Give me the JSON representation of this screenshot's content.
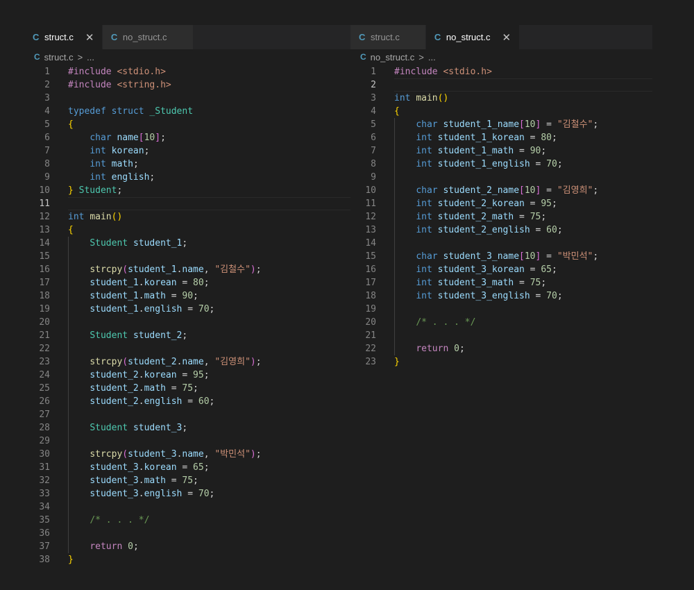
{
  "panes": [
    {
      "id": "left",
      "tabs": [
        {
          "label": "struct.c",
          "active": true,
          "closable": true
        },
        {
          "label": "no_struct.c",
          "active": false,
          "closable": false
        }
      ],
      "breadcrumb": {
        "file": "struct.c",
        "separator": ">",
        "ellipsis": "..."
      },
      "current_line": 11,
      "lines": [
        [
          [
            "ctl",
            "#include "
          ],
          [
            "inc",
            "<stdio.h>"
          ]
        ],
        [
          [
            "ctl",
            "#include "
          ],
          [
            "inc",
            "<string.h>"
          ]
        ],
        [],
        [
          [
            "kw",
            "typedef "
          ],
          [
            "kw",
            "struct "
          ],
          [
            "ty",
            "_Student"
          ]
        ],
        [
          [
            "b1",
            "{"
          ]
        ],
        [
          [
            "txt",
            "    "
          ],
          [
            "kw",
            "char "
          ],
          [
            "var",
            "name"
          ],
          [
            "b2",
            "["
          ],
          [
            "num",
            "10"
          ],
          [
            "b2",
            "]"
          ],
          [
            "txt",
            ";"
          ]
        ],
        [
          [
            "txt",
            "    "
          ],
          [
            "kw",
            "int "
          ],
          [
            "var",
            "korean"
          ],
          [
            "txt",
            ";"
          ]
        ],
        [
          [
            "txt",
            "    "
          ],
          [
            "kw",
            "int "
          ],
          [
            "var",
            "math"
          ],
          [
            "txt",
            ";"
          ]
        ],
        [
          [
            "txt",
            "    "
          ],
          [
            "kw",
            "int "
          ],
          [
            "var",
            "english"
          ],
          [
            "txt",
            ";"
          ]
        ],
        [
          [
            "b1",
            "}"
          ],
          [
            "txt",
            " "
          ],
          [
            "ty",
            "Student"
          ],
          [
            "txt",
            ";"
          ]
        ],
        [],
        [
          [
            "kw",
            "int "
          ],
          [
            "fn",
            "main"
          ],
          [
            "b1",
            "()"
          ]
        ],
        [
          [
            "b1",
            "{"
          ]
        ],
        [
          [
            "txt",
            "    "
          ],
          [
            "ty",
            "Student "
          ],
          [
            "var",
            "student_1"
          ],
          [
            "txt",
            ";"
          ]
        ],
        [],
        [
          [
            "txt",
            "    "
          ],
          [
            "fn",
            "strcpy"
          ],
          [
            "b2",
            "("
          ],
          [
            "var",
            "student_1"
          ],
          [
            "txt",
            "."
          ],
          [
            "var",
            "name"
          ],
          [
            "txt",
            ", "
          ],
          [
            "str",
            "\"김철수\""
          ],
          [
            "b2",
            ")"
          ],
          [
            "txt",
            ";"
          ]
        ],
        [
          [
            "txt",
            "    "
          ],
          [
            "var",
            "student_1"
          ],
          [
            "txt",
            "."
          ],
          [
            "var",
            "korean"
          ],
          [
            "txt",
            " = "
          ],
          [
            "num",
            "80"
          ],
          [
            "txt",
            ";"
          ]
        ],
        [
          [
            "txt",
            "    "
          ],
          [
            "var",
            "student_1"
          ],
          [
            "txt",
            "."
          ],
          [
            "var",
            "math"
          ],
          [
            "txt",
            " = "
          ],
          [
            "num",
            "90"
          ],
          [
            "txt",
            ";"
          ]
        ],
        [
          [
            "txt",
            "    "
          ],
          [
            "var",
            "student_1"
          ],
          [
            "txt",
            "."
          ],
          [
            "var",
            "english"
          ],
          [
            "txt",
            " = "
          ],
          [
            "num",
            "70"
          ],
          [
            "txt",
            ";"
          ]
        ],
        [],
        [
          [
            "txt",
            "    "
          ],
          [
            "ty",
            "Student "
          ],
          [
            "var",
            "student_2"
          ],
          [
            "txt",
            ";"
          ]
        ],
        [],
        [
          [
            "txt",
            "    "
          ],
          [
            "fn",
            "strcpy"
          ],
          [
            "b2",
            "("
          ],
          [
            "var",
            "student_2"
          ],
          [
            "txt",
            "."
          ],
          [
            "var",
            "name"
          ],
          [
            "txt",
            ", "
          ],
          [
            "str",
            "\"김영희\""
          ],
          [
            "b2",
            ")"
          ],
          [
            "txt",
            ";"
          ]
        ],
        [
          [
            "txt",
            "    "
          ],
          [
            "var",
            "student_2"
          ],
          [
            "txt",
            "."
          ],
          [
            "var",
            "korean"
          ],
          [
            "txt",
            " = "
          ],
          [
            "num",
            "95"
          ],
          [
            "txt",
            ";"
          ]
        ],
        [
          [
            "txt",
            "    "
          ],
          [
            "var",
            "student_2"
          ],
          [
            "txt",
            "."
          ],
          [
            "var",
            "math"
          ],
          [
            "txt",
            " = "
          ],
          [
            "num",
            "75"
          ],
          [
            "txt",
            ";"
          ]
        ],
        [
          [
            "txt",
            "    "
          ],
          [
            "var",
            "student_2"
          ],
          [
            "txt",
            "."
          ],
          [
            "var",
            "english"
          ],
          [
            "txt",
            " = "
          ],
          [
            "num",
            "60"
          ],
          [
            "txt",
            ";"
          ]
        ],
        [],
        [
          [
            "txt",
            "    "
          ],
          [
            "ty",
            "Student "
          ],
          [
            "var",
            "student_3"
          ],
          [
            "txt",
            ";"
          ]
        ],
        [],
        [
          [
            "txt",
            "    "
          ],
          [
            "fn",
            "strcpy"
          ],
          [
            "b2",
            "("
          ],
          [
            "var",
            "student_3"
          ],
          [
            "txt",
            "."
          ],
          [
            "var",
            "name"
          ],
          [
            "txt",
            ", "
          ],
          [
            "str",
            "\"박민석\""
          ],
          [
            "b2",
            ")"
          ],
          [
            "txt",
            ";"
          ]
        ],
        [
          [
            "txt",
            "    "
          ],
          [
            "var",
            "student_3"
          ],
          [
            "txt",
            "."
          ],
          [
            "var",
            "korean"
          ],
          [
            "txt",
            " = "
          ],
          [
            "num",
            "65"
          ],
          [
            "txt",
            ";"
          ]
        ],
        [
          [
            "txt",
            "    "
          ],
          [
            "var",
            "student_3"
          ],
          [
            "txt",
            "."
          ],
          [
            "var",
            "math"
          ],
          [
            "txt",
            " = "
          ],
          [
            "num",
            "75"
          ],
          [
            "txt",
            ";"
          ]
        ],
        [
          [
            "txt",
            "    "
          ],
          [
            "var",
            "student_3"
          ],
          [
            "txt",
            "."
          ],
          [
            "var",
            "english"
          ],
          [
            "txt",
            " = "
          ],
          [
            "num",
            "70"
          ],
          [
            "txt",
            ";"
          ]
        ],
        [],
        [
          [
            "txt",
            "    "
          ],
          [
            "com",
            "/* . . . */"
          ]
        ],
        [],
        [
          [
            "txt",
            "    "
          ],
          [
            "ctl",
            "return "
          ],
          [
            "num",
            "0"
          ],
          [
            "txt",
            ";"
          ]
        ],
        [
          [
            "b1",
            "}"
          ]
        ]
      ]
    },
    {
      "id": "right",
      "tabs": [
        {
          "label": "struct.c",
          "active": false,
          "closable": false
        },
        {
          "label": "no_struct.c",
          "active": true,
          "closable": true
        }
      ],
      "breadcrumb": {
        "file": "no_struct.c",
        "separator": ">",
        "ellipsis": "..."
      },
      "current_line": 2,
      "lines": [
        [
          [
            "ctl",
            "#include "
          ],
          [
            "inc",
            "<stdio.h>"
          ]
        ],
        [],
        [
          [
            "kw",
            "int "
          ],
          [
            "fn",
            "main"
          ],
          [
            "b1",
            "()"
          ]
        ],
        [
          [
            "b1",
            "{"
          ]
        ],
        [
          [
            "txt",
            "    "
          ],
          [
            "kw",
            "char "
          ],
          [
            "var",
            "student_1_name"
          ],
          [
            "b2",
            "["
          ],
          [
            "num",
            "10"
          ],
          [
            "b2",
            "]"
          ],
          [
            "txt",
            " = "
          ],
          [
            "str",
            "\"김철수\""
          ],
          [
            "txt",
            ";"
          ]
        ],
        [
          [
            "txt",
            "    "
          ],
          [
            "kw",
            "int "
          ],
          [
            "var",
            "student_1_korean"
          ],
          [
            "txt",
            " = "
          ],
          [
            "num",
            "80"
          ],
          [
            "txt",
            ";"
          ]
        ],
        [
          [
            "txt",
            "    "
          ],
          [
            "kw",
            "int "
          ],
          [
            "var",
            "student_1_math"
          ],
          [
            "txt",
            " = "
          ],
          [
            "num",
            "90"
          ],
          [
            "txt",
            ";"
          ]
        ],
        [
          [
            "txt",
            "    "
          ],
          [
            "kw",
            "int "
          ],
          [
            "var",
            "student_1_english"
          ],
          [
            "txt",
            " = "
          ],
          [
            "num",
            "70"
          ],
          [
            "txt",
            ";"
          ]
        ],
        [],
        [
          [
            "txt",
            "    "
          ],
          [
            "kw",
            "char "
          ],
          [
            "var",
            "student_2_name"
          ],
          [
            "b2",
            "["
          ],
          [
            "num",
            "10"
          ],
          [
            "b2",
            "]"
          ],
          [
            "txt",
            " = "
          ],
          [
            "str",
            "\"김영희\""
          ],
          [
            "txt",
            ";"
          ]
        ],
        [
          [
            "txt",
            "    "
          ],
          [
            "kw",
            "int "
          ],
          [
            "var",
            "student_2_korean"
          ],
          [
            "txt",
            " = "
          ],
          [
            "num",
            "95"
          ],
          [
            "txt",
            ";"
          ]
        ],
        [
          [
            "txt",
            "    "
          ],
          [
            "kw",
            "int "
          ],
          [
            "var",
            "student_2_math"
          ],
          [
            "txt",
            " = "
          ],
          [
            "num",
            "75"
          ],
          [
            "txt",
            ";"
          ]
        ],
        [
          [
            "txt",
            "    "
          ],
          [
            "kw",
            "int "
          ],
          [
            "var",
            "student_2_english"
          ],
          [
            "txt",
            " = "
          ],
          [
            "num",
            "60"
          ],
          [
            "txt",
            ";"
          ]
        ],
        [],
        [
          [
            "txt",
            "    "
          ],
          [
            "kw",
            "char "
          ],
          [
            "var",
            "student_3_name"
          ],
          [
            "b2",
            "["
          ],
          [
            "num",
            "10"
          ],
          [
            "b2",
            "]"
          ],
          [
            "txt",
            " = "
          ],
          [
            "str",
            "\"박민석\""
          ],
          [
            "txt",
            ";"
          ]
        ],
        [
          [
            "txt",
            "    "
          ],
          [
            "kw",
            "int "
          ],
          [
            "var",
            "student_3_korean"
          ],
          [
            "txt",
            " = "
          ],
          [
            "num",
            "65"
          ],
          [
            "txt",
            ";"
          ]
        ],
        [
          [
            "txt",
            "    "
          ],
          [
            "kw",
            "int "
          ],
          [
            "var",
            "student_3_math"
          ],
          [
            "txt",
            " = "
          ],
          [
            "num",
            "75"
          ],
          [
            "txt",
            ";"
          ]
        ],
        [
          [
            "txt",
            "    "
          ],
          [
            "kw",
            "int "
          ],
          [
            "var",
            "student_3_english"
          ],
          [
            "txt",
            " = "
          ],
          [
            "num",
            "70"
          ],
          [
            "txt",
            ";"
          ]
        ],
        [],
        [
          [
            "txt",
            "    "
          ],
          [
            "com",
            "/* . . . */"
          ]
        ],
        [],
        [
          [
            "txt",
            "    "
          ],
          [
            "ctl",
            "return "
          ],
          [
            "num",
            "0"
          ],
          [
            "txt",
            ";"
          ]
        ],
        [
          [
            "b1",
            "}"
          ]
        ]
      ]
    }
  ],
  "icons": {
    "file_type": "c-file-icon",
    "close": "close-icon",
    "chevron": "chevron-right-icon"
  },
  "colors": {
    "background": "#1e1e1e",
    "tabbar": "#252526",
    "inactive_tab": "#2d2d2d",
    "keyword": "#569cd6",
    "control": "#c586c0",
    "type": "#4ec9b0",
    "function": "#dcdcaa",
    "variable": "#9cdcfe",
    "string": "#ce9178",
    "number": "#b5cea8",
    "comment": "#6a9955",
    "bracket_1": "#ffd700",
    "bracket_2": "#da70d6",
    "c_icon": "#519aba"
  }
}
